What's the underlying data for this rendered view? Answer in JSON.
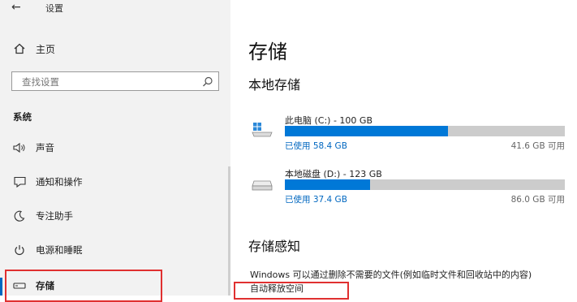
{
  "window": {
    "title": "设置"
  },
  "sidebar": {
    "home_label": "主页",
    "search_placeholder": "查找设置",
    "section": "系统",
    "items": [
      {
        "label": "声音",
        "icon": "speaker-icon"
      },
      {
        "label": "通知和操作",
        "icon": "notification-icon"
      },
      {
        "label": "专注助手",
        "icon": "moon-icon"
      },
      {
        "label": "电源和睡眠",
        "icon": "power-icon"
      },
      {
        "label": "存储",
        "icon": "storage-drive-icon"
      }
    ]
  },
  "main": {
    "title": "存储",
    "local_storage_heading": "本地存储",
    "drives": [
      {
        "name": "此电脑 (C:) - 100 GB",
        "used": "已使用 58.4 GB",
        "free": "41.6 GB 可用",
        "used_fraction": 0.584,
        "icon": "windows-drive-icon"
      },
      {
        "name": "本地磁盘 (D:) - 123 GB",
        "used": "已使用 37.4 GB",
        "free": "86.0 GB 可用",
        "used_fraction": 0.304,
        "icon": "drive-icon"
      }
    ],
    "storage_sense_heading": "存储感知",
    "storage_sense_desc_line1": "Windows 可以通过删除不需要的文件(例如临时文件和回收站中的内容)",
    "storage_sense_desc_line2": "自动释放空间"
  },
  "colors": {
    "accent": "#0078d7",
    "highlight_box": "#e03030",
    "bar_track": "#cccccc"
  }
}
